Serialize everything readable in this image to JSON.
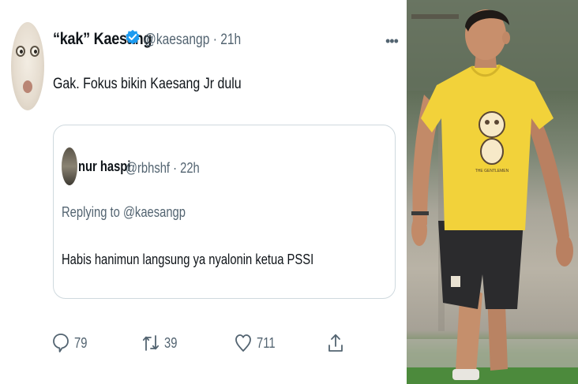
{
  "tweet": {
    "display_name": "“kak” Kaesang",
    "handle_time": "@kaesangp · 21h",
    "more_label": "•••",
    "text": "Gak. Fokus bikin Kaesang Jr dulu",
    "quoted": {
      "display_name": "nur haspi",
      "handle_time": "@rbhshf · 22h",
      "replying_prefix": "Replying to ",
      "replying_to": "@kaesangp",
      "text": "Habis hanimun langsung ya nyalonin ketua PSSI"
    },
    "actions": {
      "replies": "79",
      "retweets": "39",
      "likes": "711"
    }
  },
  "colors": {
    "verified": "#1d9bf0",
    "text_primary": "#0f1419",
    "text_secondary": "#536471",
    "border": "#cfd9de",
    "shirt": "#f2d23a"
  },
  "photo": {
    "shirt_print": "THE GENTLEMEN"
  }
}
